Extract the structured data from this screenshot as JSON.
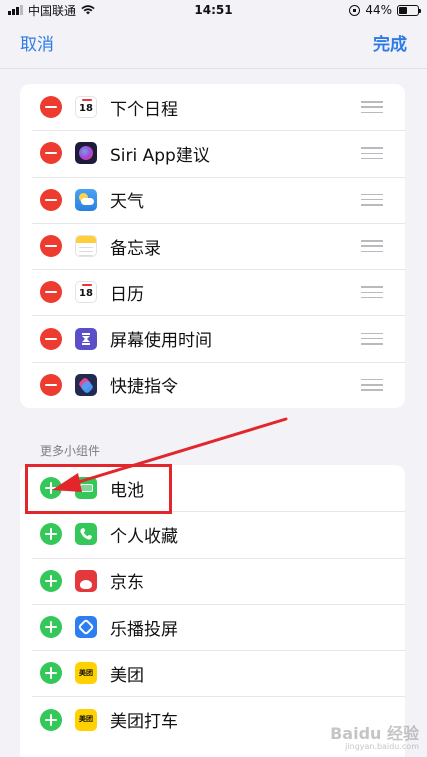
{
  "status_bar": {
    "carrier": "中国联通",
    "time": "14:51",
    "battery_percent": "44%",
    "battery_level": 0.44
  },
  "nav": {
    "cancel": "取消",
    "done": "完成"
  },
  "active_widgets": [
    {
      "label": "下个日程",
      "icon": "calendar-icon",
      "icon_text": "18"
    },
    {
      "label": "Siri App建议",
      "icon": "siri-icon"
    },
    {
      "label": "天气",
      "icon": "weather-icon"
    },
    {
      "label": "备忘录",
      "icon": "notes-icon"
    },
    {
      "label": "日历",
      "icon": "calendar-icon",
      "icon_text": "18"
    },
    {
      "label": "屏幕使用时间",
      "icon": "hourglass-icon"
    },
    {
      "label": "快捷指令",
      "icon": "shortcuts-icon"
    }
  ],
  "more_section": {
    "header": "更多小组件",
    "items": [
      {
        "label": "电池",
        "icon": "battery-icon"
      },
      {
        "label": "个人收藏",
        "icon": "phone-icon"
      },
      {
        "label": "京东",
        "icon": "jd-icon"
      },
      {
        "label": "乐播投屏",
        "icon": "lebo-icon"
      },
      {
        "label": "美团",
        "icon": "meituan-icon",
        "icon_text": "美团"
      },
      {
        "label": "美团打车",
        "icon": "meituan-icon",
        "icon_text": "美团"
      }
    ]
  },
  "colors": {
    "accent": "#2f7be6",
    "remove": "#ee3b30",
    "add": "#34c759",
    "annotation": "#e2262b"
  },
  "watermark": {
    "main": "Baidu 经验",
    "sub": "jingyan.baidu.com"
  }
}
